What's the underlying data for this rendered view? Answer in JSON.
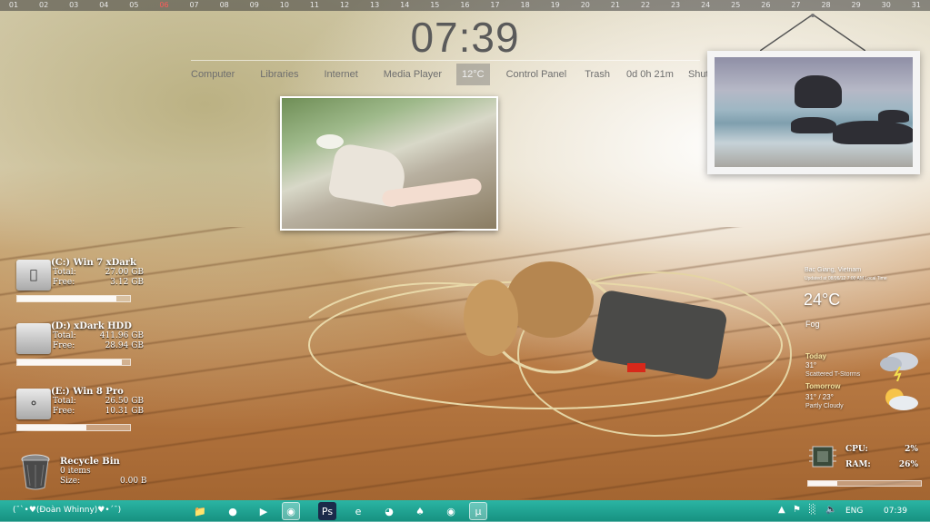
{
  "calendar": {
    "days": [
      "01",
      "02",
      "03",
      "04",
      "05",
      "06",
      "07",
      "08",
      "09",
      "10",
      "11",
      "12",
      "13",
      "14",
      "15",
      "16",
      "17",
      "18",
      "19",
      "20",
      "21",
      "22",
      "23",
      "24",
      "25",
      "26",
      "27",
      "28",
      "29",
      "30",
      "31"
    ],
    "today_index": 5
  },
  "clock": {
    "time": "07:39"
  },
  "menu": {
    "computer": "Computer",
    "libraries": "Libraries",
    "internet": "Internet",
    "media_player": "Media Player",
    "temperature": "12°C",
    "control_panel": "Control Panel",
    "trash": "Trash",
    "uptime": "0d 0h 21m",
    "shutdown": "ShutDown"
  },
  "drives": [
    {
      "title": "(C:) Win 7 xDark",
      "total_label": "Total:",
      "total": "27.00 GB",
      "free_label": "Free:",
      "free": "3.12 GB",
      "used_fraction": 0.88
    },
    {
      "title": "(D:) xDark HDD",
      "total_label": "Total:",
      "total": "411.96 GB",
      "free_label": "Free:",
      "free": "28.94 GB",
      "used_fraction": 0.93
    },
    {
      "title": "(E:) Win 8 Pro",
      "total_label": "Total:",
      "total": "26.50 GB",
      "free_label": "Free:",
      "free": "10.31 GB",
      "used_fraction": 0.61
    }
  ],
  "recycle_bin": {
    "title": "Recycle Bin",
    "items": "0 items",
    "size_label": "Size:",
    "size": "0.00 B"
  },
  "weather": {
    "location": "Bac Giang, Vietnam",
    "updated": "Updated at 08/06/12 7:00 AM Local Time",
    "temp": "24°C",
    "condition": "Fog",
    "today_label": "Today",
    "today_temp": "31°",
    "today_cond": "Scattered T-Storms",
    "tomorrow_label": "Tomorrow",
    "tomorrow_temp": "31° / 23°",
    "tomorrow_cond": "Partly Cloudy"
  },
  "sysmon": {
    "cpu_label": "CPU:",
    "cpu": "2%",
    "ram_label": "RAM:",
    "ram": "26%",
    "ram_fraction": 0.26
  },
  "taskbar": {
    "start_label": "(¯`•♥(Đoàn Whinny)♥•´¯)",
    "lang": "ENG",
    "time": "07:39"
  }
}
